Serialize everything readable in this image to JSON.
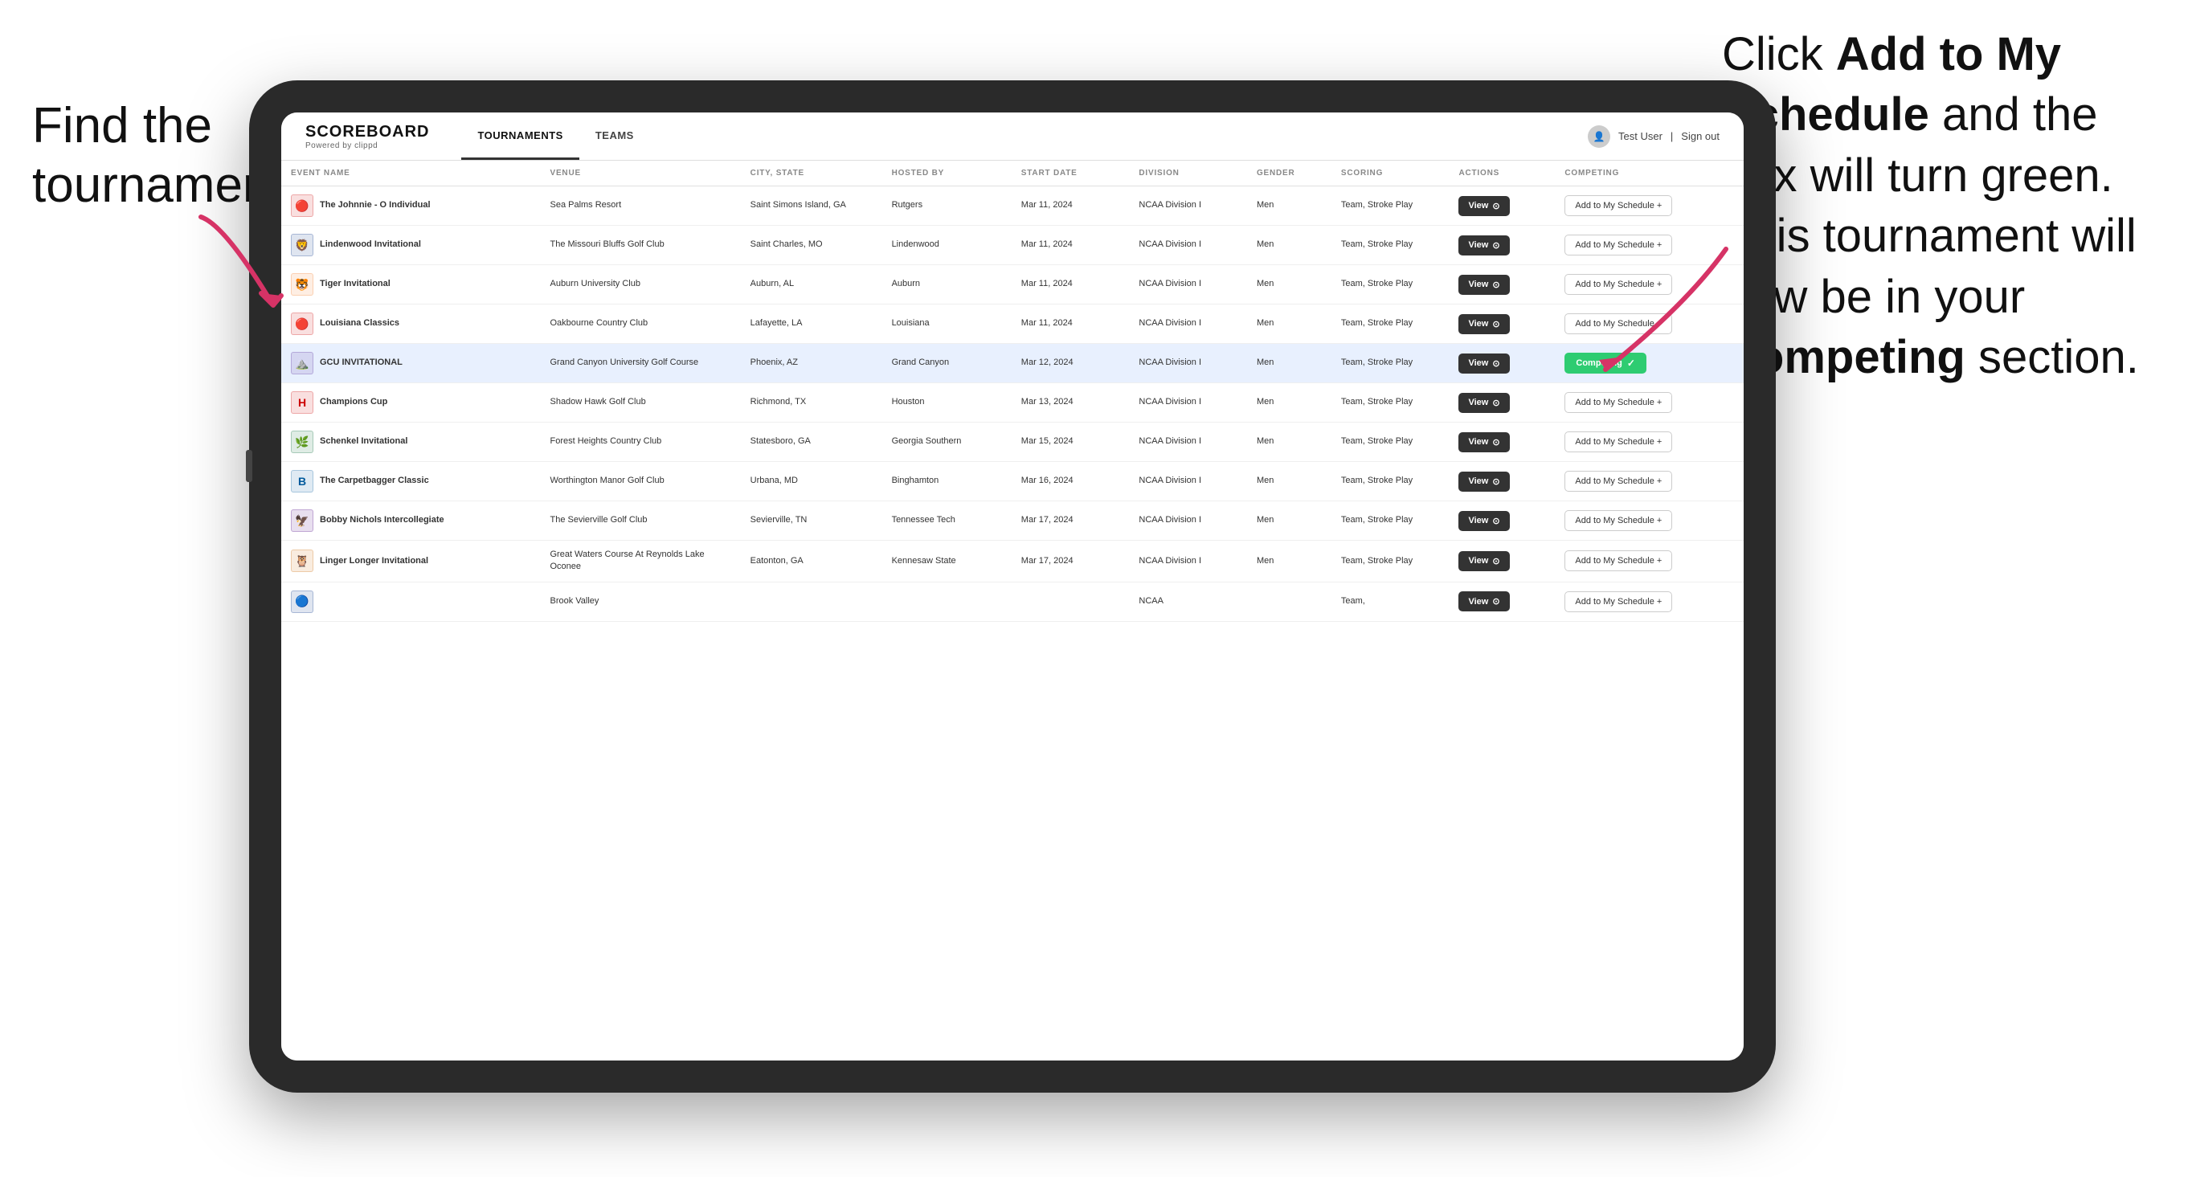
{
  "annotations": {
    "left": "Find the\ntournament.",
    "right_part1": "Click ",
    "right_bold1": "Add to My\nSchedule",
    "right_part2": " and the\nbox will turn green.\nThis tournament\nwill now be in\nyour ",
    "right_bold2": "Competing",
    "right_part3": "\nsection."
  },
  "header": {
    "logo_title": "SCOREBOARD",
    "logo_subtitle": "Powered by clippd",
    "nav": [
      {
        "label": "TOURNAMENTS",
        "active": true
      },
      {
        "label": "TEAMS",
        "active": false
      }
    ],
    "user": "Test User",
    "signout": "Sign out"
  },
  "table": {
    "columns": [
      "EVENT NAME",
      "VENUE",
      "CITY, STATE",
      "HOSTED BY",
      "START DATE",
      "DIVISION",
      "GENDER",
      "SCORING",
      "ACTIONS",
      "COMPETING"
    ],
    "rows": [
      {
        "id": 1,
        "logo_emoji": "🔴",
        "logo_color": "#cc0000",
        "event_name": "The Johnnie - O Individual",
        "venue": "Sea Palms Resort",
        "city": "Saint Simons Island, GA",
        "hosted_by": "Rutgers",
        "start_date": "Mar 11, 2024",
        "division": "NCAA Division I",
        "gender": "Men",
        "scoring": "Team, Stroke Play",
        "action": "View",
        "competing_label": "Add to My Schedule +",
        "competing_state": "add",
        "highlighted": false
      },
      {
        "id": 2,
        "logo_emoji": "🦁",
        "logo_color": "#003087",
        "event_name": "Lindenwood Invitational",
        "venue": "The Missouri Bluffs Golf Club",
        "city": "Saint Charles, MO",
        "hosted_by": "Lindenwood",
        "start_date": "Mar 11, 2024",
        "division": "NCAA Division I",
        "gender": "Men",
        "scoring": "Team, Stroke Play",
        "action": "View",
        "competing_label": "Add to My Schedule +",
        "competing_state": "add",
        "highlighted": false
      },
      {
        "id": 3,
        "logo_emoji": "🐯",
        "logo_color": "#f47920",
        "event_name": "Tiger Invitational",
        "venue": "Auburn University Club",
        "city": "Auburn, AL",
        "hosted_by": "Auburn",
        "start_date": "Mar 11, 2024",
        "division": "NCAA Division I",
        "gender": "Men",
        "scoring": "Team, Stroke Play",
        "action": "View",
        "competing_label": "Add to My Schedule +",
        "competing_state": "add",
        "highlighted": false
      },
      {
        "id": 4,
        "logo_emoji": "🔴",
        "logo_color": "#cc0000",
        "event_name": "Louisiana Classics",
        "venue": "Oakbourne Country Club",
        "city": "Lafayette, LA",
        "hosted_by": "Louisiana",
        "start_date": "Mar 11, 2024",
        "division": "NCAA Division I",
        "gender": "Men",
        "scoring": "Team, Stroke Play",
        "action": "View",
        "competing_label": "Add to My Schedule +",
        "competing_state": "add",
        "highlighted": false
      },
      {
        "id": 5,
        "logo_emoji": "⛰️",
        "logo_color": "#522398",
        "event_name": "GCU INVITATIONAL",
        "venue": "Grand Canyon University Golf Course",
        "city": "Phoenix, AZ",
        "hosted_by": "Grand Canyon",
        "start_date": "Mar 12, 2024",
        "division": "NCAA Division I",
        "gender": "Men",
        "scoring": "Team, Stroke Play",
        "action": "View",
        "competing_label": "Competing ✓",
        "competing_state": "competing",
        "highlighted": true
      },
      {
        "id": 6,
        "logo_emoji": "H",
        "logo_color": "#cc0000",
        "event_name": "Champions Cup",
        "venue": "Shadow Hawk Golf Club",
        "city": "Richmond, TX",
        "hosted_by": "Houston",
        "start_date": "Mar 13, 2024",
        "division": "NCAA Division I",
        "gender": "Men",
        "scoring": "Team, Stroke Play",
        "action": "View",
        "competing_label": "Add to My Schedule +",
        "competing_state": "add",
        "highlighted": false
      },
      {
        "id": 7,
        "logo_emoji": "🌿",
        "logo_color": "#006633",
        "event_name": "Schenkel Invitational",
        "venue": "Forest Heights Country Club",
        "city": "Statesboro, GA",
        "hosted_by": "Georgia Southern",
        "start_date": "Mar 15, 2024",
        "division": "NCAA Division I",
        "gender": "Men",
        "scoring": "Team, Stroke Play",
        "action": "View",
        "competing_label": "Add to My Schedule +",
        "competing_state": "add",
        "highlighted": false
      },
      {
        "id": 8,
        "logo_emoji": "B",
        "logo_color": "#005a9c",
        "event_name": "The Carpetbagger Classic",
        "venue": "Worthington Manor Golf Club",
        "city": "Urbana, MD",
        "hosted_by": "Binghamton",
        "start_date": "Mar 16, 2024",
        "division": "NCAA Division I",
        "gender": "Men",
        "scoring": "Team, Stroke Play",
        "action": "View",
        "competing_label": "Add to My Schedule +",
        "competing_state": "add",
        "highlighted": false
      },
      {
        "id": 9,
        "logo_emoji": "🦅",
        "logo_color": "#4b0082",
        "event_name": "Bobby Nichols Intercollegiate",
        "venue": "The Sevierville Golf Club",
        "city": "Sevierville, TN",
        "hosted_by": "Tennessee Tech",
        "start_date": "Mar 17, 2024",
        "division": "NCAA Division I",
        "gender": "Men",
        "scoring": "Team, Stroke Play",
        "action": "View",
        "competing_label": "Add to My Schedule +",
        "competing_state": "add",
        "highlighted": false
      },
      {
        "id": 10,
        "logo_emoji": "🦉",
        "logo_color": "#cc6600",
        "event_name": "Linger Longer Invitational",
        "venue": "Great Waters Course At Reynolds Lake Oconee",
        "city": "Eatonton, GA",
        "hosted_by": "Kennesaw State",
        "start_date": "Mar 17, 2024",
        "division": "NCAA Division I",
        "gender": "Men",
        "scoring": "Team, Stroke Play",
        "action": "View",
        "competing_label": "Add to My Schedule +",
        "competing_state": "add",
        "highlighted": false
      },
      {
        "id": 11,
        "logo_emoji": "🔵",
        "logo_color": "#003087",
        "event_name": "",
        "venue": "Brook Valley",
        "city": "",
        "hosted_by": "",
        "start_date": "",
        "division": "NCAA",
        "gender": "",
        "scoring": "Team,",
        "action": "View",
        "competing_label": "Add to My Schedule +",
        "competing_state": "add",
        "highlighted": false
      }
    ]
  }
}
